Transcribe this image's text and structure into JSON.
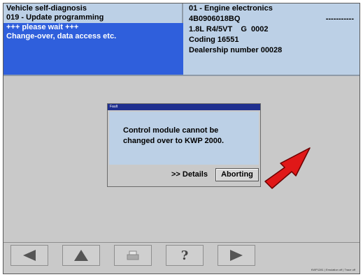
{
  "header": {
    "left": {
      "title": "Vehicle self-diagnosis",
      "function": "019 - Update programming",
      "status_line1": "+++ please wait +++",
      "status_line2": "Change-over, data access etc."
    },
    "right": {
      "module": "01 - Engine electronics",
      "part_number": "4B0906018BQ",
      "dashes": "-----------",
      "engine": "1.8L R4/5VT    G  0002",
      "coding": "Coding 16551",
      "dealership": "Dealership number 00028"
    }
  },
  "dialog": {
    "title": "Fault",
    "message_line1": "Control module cannot be",
    "message_line2": "changed over to KWP 2000.",
    "details_label": ">> Details",
    "abort_label": "Aborting"
  },
  "toolbar": {
    "buttons": [
      {
        "icon": "back-arrow-icon"
      },
      {
        "icon": "up-arrow-icon"
      },
      {
        "icon": "print-icon"
      },
      {
        "icon": "help-icon",
        "glyph": "?"
      },
      {
        "icon": "forward-arrow-icon"
      }
    ]
  },
  "statusbar": {
    "text": "KWP1281  |  Emulation off  |  Trace off"
  },
  "colors": {
    "header_bg": "#bcd0e6",
    "selection": "#2f5fdc",
    "dialog_title": "#1f2f8f",
    "annotation_arrow": "#e01818"
  }
}
